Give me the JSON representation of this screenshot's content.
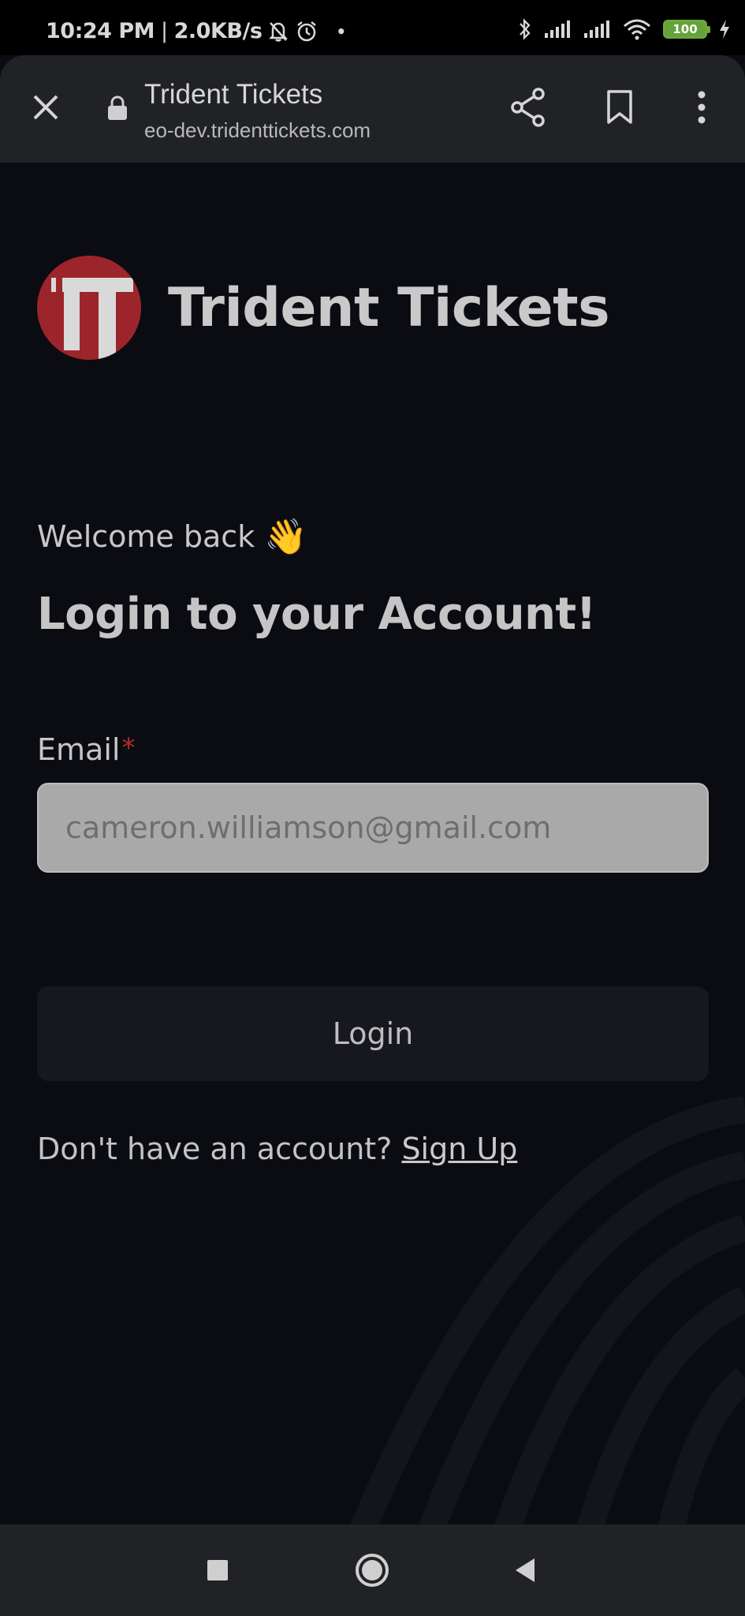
{
  "status_bar": {
    "time": "10:24 PM",
    "separator": "|",
    "net_speed": "2.0KB/s",
    "dot": "•",
    "battery_level": "100",
    "icons": [
      "mute-bell-icon",
      "alarm-icon",
      "bluetooth-icon",
      "signal-icon",
      "signal-icon",
      "wifi-icon",
      "battery-icon",
      "charging-icon"
    ]
  },
  "browser": {
    "title": "Trident Tickets",
    "url": "eo-dev.tridenttickets.com",
    "icons": [
      "close-icon",
      "lock-icon",
      "share-icon",
      "bookmark-icon",
      "more-vertical-icon"
    ]
  },
  "page": {
    "brand_name": "Trident Tickets",
    "welcome_text": "Welcome back",
    "welcome_emoji": "👋",
    "heading": "Login to your Account!",
    "email_label": "Email",
    "required_marker": "*",
    "email_placeholder": "cameron.williamson@gmail.com",
    "login_button": "Login",
    "signup_prompt": "Don't have an account?",
    "signup_link": "Sign Up"
  },
  "nav_bar": {
    "icons": [
      "recents-square-icon",
      "home-circle-icon",
      "back-triangle-icon"
    ]
  },
  "colors": {
    "background": "#0b0c12",
    "brand_red": "#9c252b",
    "input_bg": "#a9a9a9",
    "button_bg": "#17181f",
    "required_red": "#b22a2e",
    "battery_green": "#64a23a"
  }
}
